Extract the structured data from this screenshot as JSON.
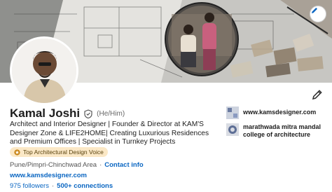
{
  "profile": {
    "name": "Kamal Joshi",
    "pronouns": "(He/Him)",
    "headline": "Architect and Interior Designer | Founder & Director at KAM'S Designer Zone & LIFE2HOME| Creating Luxurious Residences and Premium Offices | Specialist in Turnkey Projects",
    "badge": "Top Architectural Design Voice",
    "location": "Pune/Pimpri-Chinchwad Area",
    "location_separator": "·",
    "contact_info": "Contact info",
    "website": "www.kamsdesigner.com",
    "followers": "975 followers",
    "stats_separator": "·",
    "connections": "500+ connections"
  },
  "side_panel": {
    "company": "www.kamsdesigner.com",
    "education": "marathwada mitra mandal college of architecture"
  },
  "icons": {
    "banner_edit": "pencil-icon",
    "profile_edit": "pencil-icon",
    "verified": "verified-shield-icon",
    "badge": "star-badge-icon"
  },
  "colors": {
    "link": "#0a66c2",
    "badge_bg": "#fbe8c6"
  }
}
